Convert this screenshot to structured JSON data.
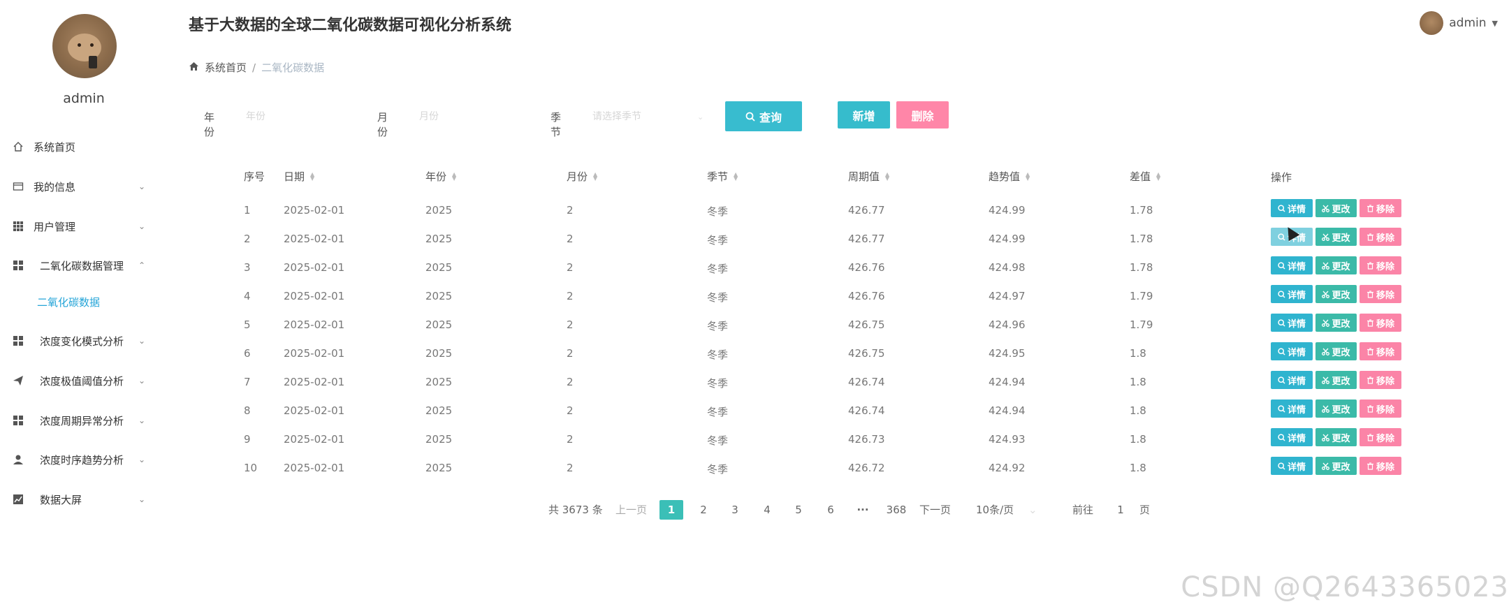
{
  "app": {
    "title": "基于大数据的全球二氧化碳数据可视化分析系统",
    "user": "admin"
  },
  "sidebar": {
    "username": "admin",
    "items": [
      {
        "label": "系统首页",
        "icon": "home-icon",
        "arrow": ""
      },
      {
        "label": "我的信息",
        "icon": "profile-card-icon",
        "arrow": "⌄"
      },
      {
        "label": "用户管理",
        "icon": "grid-icon",
        "arrow": "⌄"
      },
      {
        "label": "二氧化碳数据管理",
        "icon": "grid-icon",
        "arrow": "⌃"
      },
      {
        "label": "二氧化碳数据",
        "icon": "",
        "arrow": ""
      },
      {
        "label": "浓度变化模式分析",
        "icon": "grid-icon",
        "arrow": "⌄"
      },
      {
        "label": "浓度极值阈值分析",
        "icon": "send-icon",
        "arrow": "⌄"
      },
      {
        "label": "浓度周期异常分析",
        "icon": "grid-icon",
        "arrow": "⌄"
      },
      {
        "label": "浓度时序趋势分析",
        "icon": "user-icon",
        "arrow": "⌄"
      },
      {
        "label": "数据大屏",
        "icon": "chart-icon",
        "arrow": "⌄"
      }
    ]
  },
  "breadcrumb": {
    "home": "系统首页",
    "separator": "/",
    "current": "二氧化碳数据"
  },
  "filters": {
    "year_label": "年份",
    "year_placeholder": "年份",
    "month_label": "月份",
    "month_placeholder": "月份",
    "season_label": "季节",
    "season_placeholder": "请选择季节",
    "search_label": "查询",
    "add_label": "新增",
    "delete_label": "删除"
  },
  "table": {
    "headers": [
      "序号",
      "日期",
      "年份",
      "月份",
      "季节",
      "周期值",
      "趋势值",
      "差值",
      "操作"
    ],
    "rows": [
      [
        "1",
        "2025-02-01",
        "2025",
        "2",
        "冬季",
        "426.77",
        "424.99",
        "1.78"
      ],
      [
        "2",
        "2025-02-01",
        "2025",
        "2",
        "冬季",
        "426.77",
        "424.99",
        "1.78"
      ],
      [
        "3",
        "2025-02-01",
        "2025",
        "2",
        "冬季",
        "426.76",
        "424.98",
        "1.78"
      ],
      [
        "4",
        "2025-02-01",
        "2025",
        "2",
        "冬季",
        "426.76",
        "424.97",
        "1.79"
      ],
      [
        "5",
        "2025-02-01",
        "2025",
        "2",
        "冬季",
        "426.75",
        "424.96",
        "1.79"
      ],
      [
        "6",
        "2025-02-01",
        "2025",
        "2",
        "冬季",
        "426.75",
        "424.95",
        "1.8"
      ],
      [
        "7",
        "2025-02-01",
        "2025",
        "2",
        "冬季",
        "426.74",
        "424.94",
        "1.8"
      ],
      [
        "8",
        "2025-02-01",
        "2025",
        "2",
        "冬季",
        "426.74",
        "424.94",
        "1.8"
      ],
      [
        "9",
        "2025-02-01",
        "2025",
        "2",
        "冬季",
        "426.73",
        "424.93",
        "1.8"
      ],
      [
        "10",
        "2025-02-01",
        "2025",
        "2",
        "冬季",
        "426.72",
        "424.92",
        "1.8"
      ]
    ],
    "actions": {
      "detail": "详情",
      "edit": "更改",
      "remove": "移除"
    }
  },
  "pagination": {
    "total": "共 3673 条",
    "prev": "上一页",
    "pages": [
      "1",
      "2",
      "3",
      "4",
      "5",
      "6"
    ],
    "ellipsis": "···",
    "last": "368",
    "next": "下一页",
    "page_size": "10条/页",
    "goto_label": "前往",
    "goto_value": "1",
    "page_unit": "页"
  },
  "watermark": "CSDN @Q2643365023",
  "colors": {
    "primary": "#38bccf",
    "danger": "#ff86a8",
    "edit": "#3bbaa8",
    "active_menu": "#26a5d8"
  }
}
